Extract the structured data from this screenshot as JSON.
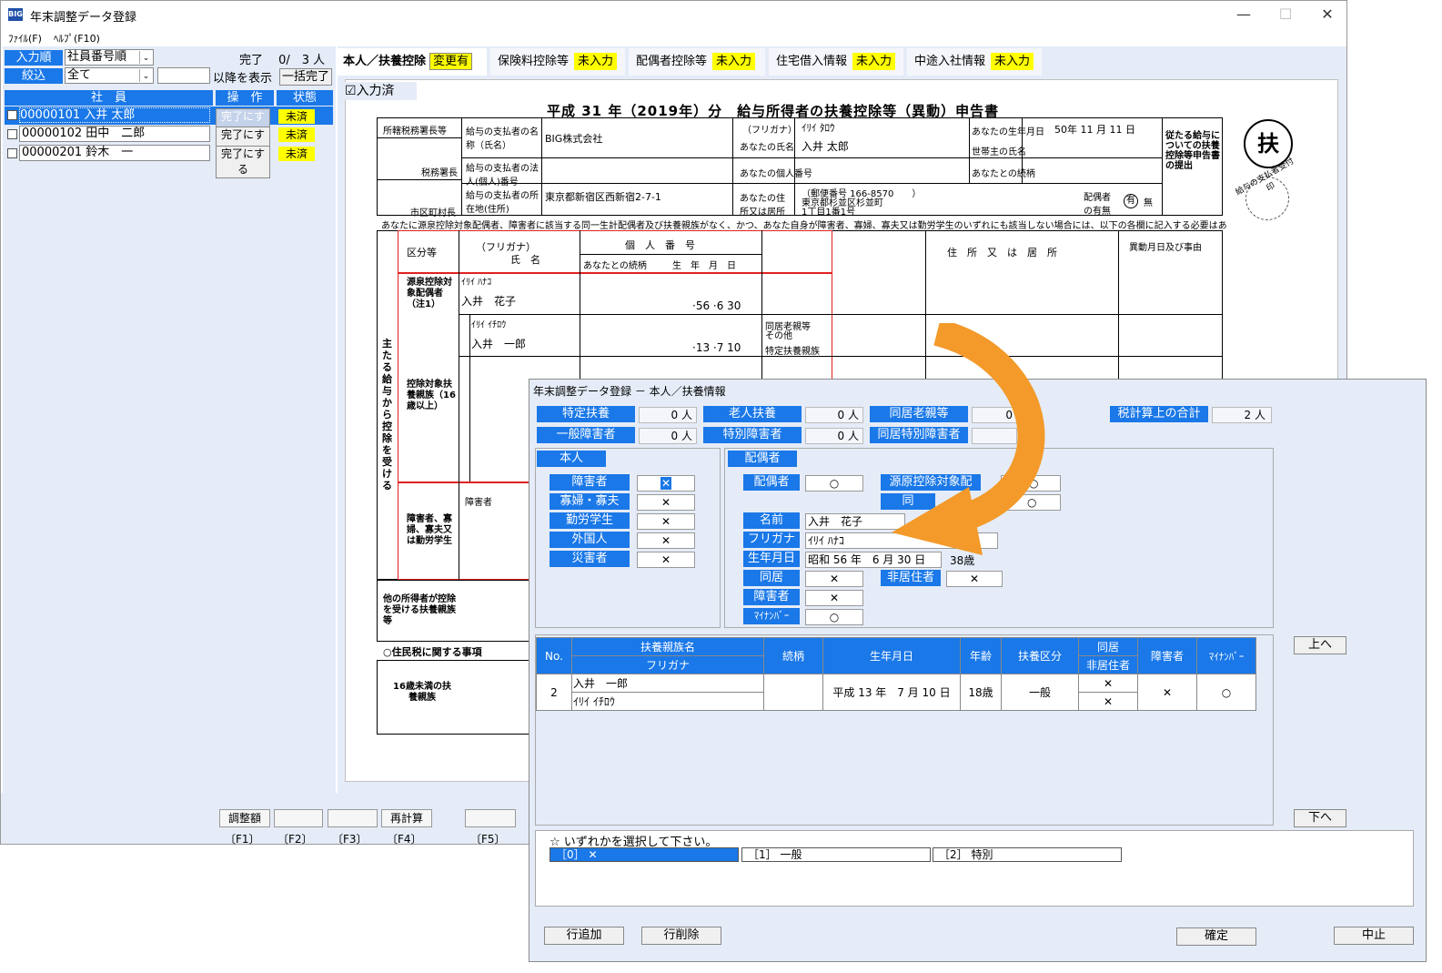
{
  "window": {
    "app_icon": "BIG",
    "title": "年末調整データ登録",
    "menu": [
      "ﾌｧｲﾙ(F)",
      "ﾍﾙﾌﾟ(F10)"
    ]
  },
  "left": {
    "sort_label": "入力順",
    "sort_value": "社員番号順",
    "filter_label": "絞込",
    "filter_value": "全て",
    "filter_suffix": "以降を表示",
    "status_text": "完了　 0/　3 人",
    "bulk_button": "一括完了",
    "columns": [
      "社　員",
      "操　作",
      "状態"
    ],
    "employees": [
      {
        "name": "00000101 入井 太郎",
        "action": "完了にする",
        "status": "未済"
      },
      {
        "name": "00000102 田中　二郎",
        "action": "完了にする",
        "status": "未済"
      },
      {
        "name": "00000201 鈴木　一",
        "action": "完了にする",
        "status": "未済"
      }
    ]
  },
  "tabs": [
    {
      "label": "本人／扶養控除",
      "badge": "変更有"
    },
    {
      "label": "保険料控除等",
      "badge": "未入力"
    },
    {
      "label": "配偶者控除等",
      "badge": "未入力"
    },
    {
      "label": "住宅借入情報",
      "badge": "未入力"
    },
    {
      "label": "中途入社情報",
      "badge": "未入力"
    }
  ],
  "doc": {
    "input_done": "入力済",
    "title": "平成 31 年（2019年）分　給与所得者の扶養控除等（異動）申告書",
    "fu_char": "扶",
    "payer_name": "BIG株式会社",
    "payer_address": "東京都新宿区西新宿2-7-1",
    "furigana": "ｲﾘｲ ﾀﾛｳ",
    "your_name": "入井 太郎",
    "birth": "50年 11 月 11 日",
    "postal": "（郵便番号 166-8570　　）",
    "address1": "東京都杉並区杉並町",
    "address2": "1丁目1番1号",
    "spouse_furigana": "ｲﾘｲ ﾊﾅｺ",
    "spouse_name": "入井　花子",
    "spouse_birth": "·56 ·6 30",
    "dep1_furigana": "ｲﾘｲ ｲﾁﾛｳ",
    "dep1_name": "入井　一郎",
    "dep1_birth": "·13 ·7 10",
    "notice": "あなたに源泉控除対象配偶者、障害者に該当する同一生計配偶者及び扶養親族がなく、かつ、あなた自身が障害者、寡婦、寡夫又は勤労学生のいずれにも該当しない場合には、以下の各欄に記入する必要はありません。",
    "labels": {
      "tax_office": "所轄税務署長等",
      "tax_chief": "税務署長",
      "city_chief": "市区町村長",
      "payer_name_lbl": "給与の支払者の名称（氏名）",
      "payer_no_lbl": "給与の支払者の法人(個人)番号",
      "payer_addr_lbl": "給与の支払者の所在地(住所)",
      "furigana_lbl": "（フリガナ）",
      "name_lbl": "あなたの氏名",
      "my_number_lbl": "あなたの個人番号",
      "address_lbl": "あなたの住所又は居所",
      "birth_lbl": "あなたの生年月日",
      "head_lbl": "世帯主の氏名",
      "rel_lbl": "あなたとの続柄",
      "spouse_lbl": "配偶者の有無",
      "yes": "有",
      "no": "無",
      "section_main": "主たる給与から控除を受ける",
      "sec_a": "源泉控除対象配偶者（注1）",
      "sec_b": "控除対象扶養親族（16歳以上）",
      "sec_c": "障害者、寡婦、寡夫又は勤労学生",
      "sec_d": "他の所得者が控除を受ける扶養親族等",
      "kubun": "区分等",
      "furigana_col": "（フリガナ）",
      "shimei": "氏　名",
      "kojin": "個　人　番　号",
      "zokugara": "あなたとの続柄",
      "seinen": "生　年　月　日",
      "address_col": "住　所　又　は　居　所",
      "ido": "異動月日及び事由",
      "resident_tax": "○住民税に関する事項",
      "under16": "16歳未満の扶養親族",
      "old_together": "同居老親等",
      "other": "その他",
      "special": "特定扶養親族",
      "disabled": "障害者",
      "stamp": "給与の支払者受付印",
      "side_note": "従たる給与についての扶養控除等申告書の提出"
    }
  },
  "bottom": {
    "buttons": [
      "調整額",
      "",
      "",
      "再計算",
      ""
    ],
    "fkeys": [
      "〔F1〕",
      "〔F2〕",
      "〔F3〕",
      "〔F4〕",
      "〔F5〕"
    ]
  },
  "dialog": {
    "title": "年末調整データ登録 － 本人／扶養情報",
    "summary": [
      {
        "label": "特定扶養",
        "value": "0 人"
      },
      {
        "label": "老人扶養",
        "value": "0 人"
      },
      {
        "label": "同居老親等",
        "value": "0"
      },
      {
        "label": "一般障害者",
        "value": "0 人"
      },
      {
        "label": "特別障害者",
        "value": "0 人"
      },
      {
        "label": "同居特別障害者",
        "value": ""
      }
    ],
    "tax_total_label": "税計算上の合計",
    "tax_total_value": "2 人",
    "self_title": "本人",
    "self_rows": [
      {
        "label": "障害者",
        "value": "✕"
      },
      {
        "label": "寡婦・寡夫",
        "value": "✕"
      },
      {
        "label": "勤労学生",
        "value": "✕"
      },
      {
        "label": "外国人",
        "value": "✕"
      },
      {
        "label": "災害者",
        "value": "✕"
      }
    ],
    "spouse_title": "配偶者",
    "spouse": {
      "haigusha_label": "配偶者",
      "haigusha_value": "○",
      "gensen_label": "源原控除対象配",
      "gensen_value": "○",
      "doukyo2_label": "同",
      "doukyo2_value": "○",
      "name_label": "名前",
      "name_value": "入井　花子",
      "furigana_label": "フリガナ",
      "furigana_value": "ｲﾘｲ ﾊﾅｺ",
      "birth_label": "生年月日",
      "birth_value": "昭和 56 年　6 月 30 日",
      "age_value": "38歳",
      "doukyo_label": "同居",
      "doukyo_value": "✕",
      "hikyo_label": "非居住者",
      "hikyo_value": "✕",
      "disabled_label": "障害者",
      "disabled_value": "✕",
      "mynumber_label": "ﾏｲﾅﾝﾊﾞｰ",
      "mynumber_value": "○"
    },
    "table": {
      "headers": {
        "no": "No.",
        "name": "扶養親族名",
        "furigana": "フリガナ",
        "rel": "続柄",
        "birth": "生年月日",
        "age": "年齢",
        "kubun": "扶養区分",
        "doukyo": "同居",
        "hikyo": "非居住者",
        "disabled": "障害者",
        "mynumber": "ﾏｲﾅﾝﾊﾞｰ"
      },
      "rows": [
        {
          "no": "2",
          "name": "入井　一郎",
          "furigana": "ｲﾘｲ ｲﾁﾛｳ",
          "rel": "",
          "birth": "平成 13 年　7 月 10 日",
          "age": "18歳",
          "kubun": "一般",
          "doukyo": "✕",
          "hikyo": "✕",
          "disabled": "✕",
          "mynumber": "○"
        }
      ]
    },
    "up_button": "上へ",
    "down_button": "下へ",
    "prompt": "☆ いずれかを選択して下さい。",
    "options": [
      "［0］ ✕",
      "［1］ 一般",
      "［2］ 特別"
    ],
    "add_button": "行追加",
    "delete_button": "行削除",
    "ok_button": "確定",
    "cancel_button": "中止"
  },
  "colors": {
    "label_blue": "#1a78e8",
    "panel_bg": "#e5ecf8",
    "badge_yellow": "#ffff00",
    "arrow_orange": "#f39a2a",
    "form_red": "#e02020"
  }
}
